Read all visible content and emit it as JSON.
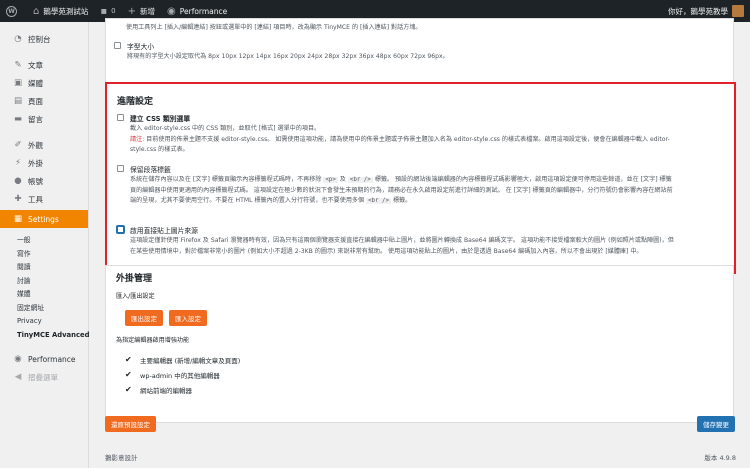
{
  "adminbar": {
    "wp_logo": "W",
    "site_name": "鵝學苑測試站",
    "comments_count": "0",
    "new_label": "新增",
    "performance_label": "Performance",
    "greeting": "你好，鵝學苑教學"
  },
  "sidebar": {
    "top_items": [
      {
        "label": "控制台",
        "icon": "dashboard-icon"
      },
      {
        "label": "文章",
        "icon": "pin-icon"
      },
      {
        "label": "媒體",
        "icon": "media-icon"
      },
      {
        "label": "頁面",
        "icon": "page-icon"
      },
      {
        "label": "留言",
        "icon": "comment-icon"
      },
      {
        "label": "外觀",
        "icon": "brush-icon"
      },
      {
        "label": "外掛",
        "icon": "plugin-icon"
      },
      {
        "label": "帳號",
        "icon": "user-icon"
      },
      {
        "label": "工具",
        "icon": "wrench-icon"
      },
      {
        "label": "Settings",
        "icon": "settings-icon"
      }
    ],
    "sub_items": [
      "一般",
      "寫作",
      "閱讀",
      "討論",
      "媒體",
      "固定網址",
      "Privacy",
      "TinyMCE Advanced"
    ],
    "performance": "Performance",
    "collapse": "摺疊選單"
  },
  "top_card": {
    "line1": "使用工具列上 [插入/編輯連結] 按鈕或選單中的 [連結] 項目時，改為顯示 TinyMCE 的 [插入連結] 對話方塊。",
    "font_size_title": "字型大小",
    "font_size_desc": "將現有的字型大小設定取代為 8px 10px 12px 14px 16px 20px 24px 28px 32px 36px 48px 60px 72px 96px。"
  },
  "advanced": {
    "title": "進階設定",
    "css_title": "建立 CSS 類別選單",
    "css_desc1": "載入 editor-style.css 中的 CSS 類別，並取代 [格式] 選單中的項目。",
    "css_note_label": "請注:",
    "css_desc2": " 目前使用的佈景主題不支援 editor-style.css。 如需使用這項功能，請為使用中的佈景主題或子佈景主題加入名為 editor-style.css 的樣式表檔案。啟用這項設定後，便會在編輯器中載入 editor-",
    "css_desc3": "style.css 的樣式表。",
    "para_title": "保留段落標籤",
    "para_desc_a": "系統在儲存內容以及在 [文字] 標籤頁顯示內容標籤程式碼時，不再移除 ",
    "para_code_p": "<p>",
    "para_desc_b": " 及 ",
    "para_code_br": "<br />",
    "para_desc_c": " 標籤。 預設的網站後端編輯器的內容標籤程式碼影響極大，啟用這項設定便可停用這些餘道，並在 [文字] 標籤",
    "para_desc_line2": "頁的編輯器中使用更適用的內容標籤程式碼。 這項設定在極少數的狀況下會發生未預期的行為，請務必在永久啟用設定前進行詳細的測試。 在 [文字] 標籤頁的編輯器中，分行符號仍會影響內容在網站前",
    "para_desc_line3a": "端的呈現，尤其不要使用空行。不要在 HTML 標籤內的置入分行符號，也不要使用多個 ",
    "para_desc_line3b": " 標籤。",
    "paste_title": "啟用直接貼上圖片來源",
    "paste_desc1": "這項設定僅針使用 Firefox 及 Safari 瀏覽器時有效，因為只有這兩個瀏覽器支援直接在編輯器中貼上圖片，並將圖片轉換成 Base64 編碼文字。 這項功能不接受檔案較大的圖片 (例如照片或點陣圖)，但",
    "paste_desc2": "在某些使用情境中，對於檔案非常小的圖片 (例如大小不超過 2-3KB 的圖示) 來說非常有幫助。 使用這項功能貼上的圖片，由於是透過 Base64 編碼加入內容，所以不會出現於 [媒體庫] 中。"
  },
  "plugin_mgmt": {
    "title": "外掛管理",
    "import_export_label": "匯入/匯出設定",
    "export_button": "匯出設定",
    "import_button": "匯入設定",
    "enable_label": "為指定編輯器啟用增強功能",
    "checks": [
      "主要編輯器 (新增/編輯文章及頁面)",
      "wp-admin 中的其他編輯器",
      "網站前端的編輯器"
    ]
  },
  "footer": {
    "restore_button": "還原預設設定",
    "save_button": "儲存變更",
    "credit": "鵝影意設計",
    "version": "版本 4.9.8"
  },
  "colors": {
    "accent_orange": "#f18500",
    "button_orange": "#f06a1f",
    "primary_blue": "#2271b1",
    "highlight_red": "#e0212b"
  }
}
